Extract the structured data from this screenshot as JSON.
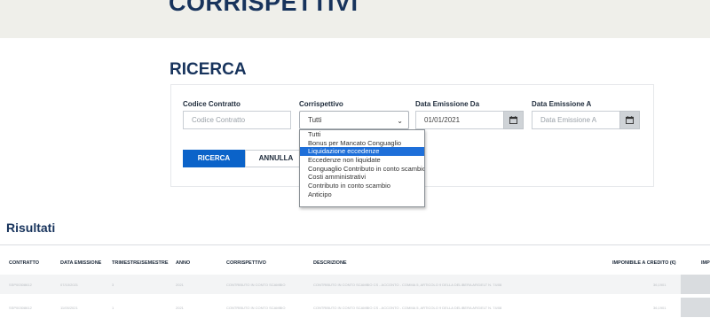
{
  "banner": {
    "title": "CORRISPETTIVI"
  },
  "search": {
    "title": "RICERCA",
    "codice_contratto": {
      "label": "Codice Contratto",
      "placeholder": "Codice Contratto"
    },
    "corrispettivo": {
      "label": "Corrispettivo",
      "selected": "Tutti",
      "options": [
        "Tutti",
        "Bonus per Mancato Conguaglio",
        "Liquidazione eccedenze",
        "Eccedenze non liquidate",
        "Conguaglio Contributo in conto scambio",
        "Costi amministrativi",
        "Contributo in conto scambio",
        "Anticipo"
      ],
      "highlighted": "Liquidazione eccedenze"
    },
    "data_da": {
      "label": "Data Emissione Da",
      "value": "01/01/2021"
    },
    "data_a": {
      "label": "Data Emissione A",
      "placeholder": "Data Emissione A"
    },
    "buttons": {
      "search": "RICERCA",
      "cancel": "ANNULLA"
    }
  },
  "results": {
    "title": "Risultati",
    "columns": [
      "CONTRATTO",
      "DATA EMISSIONE",
      "TRIMESTRE/SEMESTRE",
      "ANNO",
      "CORRISPETTIVO",
      "DESCRIZIONE",
      "IMPONIBILE A CREDITO (€)",
      "IMP"
    ],
    "rows": [
      [
        "SSP00308612",
        "07/10/2021",
        "3",
        "2021",
        "CONTRIBUTO IN CONTO SCAMBIO",
        "CONTRIBUTO IN CONTO SCAMBIO CS - ACCONTO - COMMA 5, ARTICOLO 9 DELLA DELIBERA ARG/ELT N. 74/08",
        "36,1901"
      ],
      [
        "SSP00308612",
        "11/05/2021",
        "1",
        "2021",
        "CONTRIBUTO IN CONTO SCAMBIO",
        "CONTRIBUTO IN CONTO SCAMBIO CS - ACCONTO - COMMA 5, ARTICOLO 9 DELLA DELIBERA ARG/ELT N. 74/08",
        "36,1901"
      ]
    ]
  }
}
